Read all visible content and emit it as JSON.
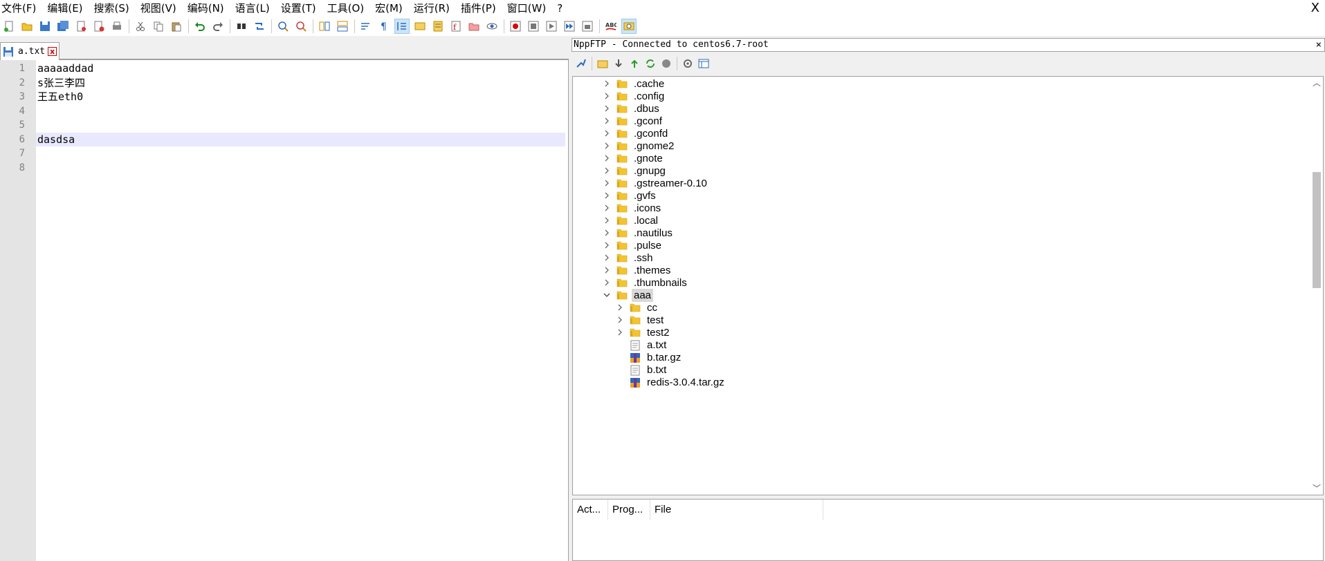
{
  "menu": [
    "文件(F)",
    "编辑(E)",
    "搜索(S)",
    "视图(V)",
    "编码(N)",
    "语言(L)",
    "设置(T)",
    "工具(O)",
    "宏(M)",
    "运行(R)",
    "插件(P)",
    "窗口(W)",
    "?"
  ],
  "window_close": "X",
  "tab": {
    "label": "a.txt",
    "close": "x"
  },
  "editor": {
    "lines": [
      {
        "num": "1",
        "text": "aaaaaddad"
      },
      {
        "num": "2",
        "text": "s张三李四"
      },
      {
        "num": "3",
        "text": "王五eth0"
      },
      {
        "num": "4",
        "text": ""
      },
      {
        "num": "5",
        "text": ""
      },
      {
        "num": "6",
        "text": "dasdsa"
      },
      {
        "num": "7",
        "text": ""
      },
      {
        "num": "8",
        "text": ""
      }
    ],
    "current_line": 6
  },
  "ftp": {
    "title": "NppFTP - Connected to centos6.7-root",
    "close": "×",
    "tree": [
      {
        "label": ".cache",
        "type": "folder",
        "expanded": false
      },
      {
        "label": ".config",
        "type": "folder",
        "expanded": false
      },
      {
        "label": ".dbus",
        "type": "folder",
        "expanded": false
      },
      {
        "label": ".gconf",
        "type": "folder",
        "expanded": false
      },
      {
        "label": ".gconfd",
        "type": "folder",
        "expanded": false
      },
      {
        "label": ".gnome2",
        "type": "folder",
        "expanded": false
      },
      {
        "label": ".gnote",
        "type": "folder",
        "expanded": false
      },
      {
        "label": ".gnupg",
        "type": "folder",
        "expanded": false
      },
      {
        "label": ".gstreamer-0.10",
        "type": "folder",
        "expanded": false
      },
      {
        "label": ".gvfs",
        "type": "folder",
        "expanded": false
      },
      {
        "label": ".icons",
        "type": "folder",
        "expanded": false
      },
      {
        "label": ".local",
        "type": "folder",
        "expanded": false
      },
      {
        "label": ".nautilus",
        "type": "folder",
        "expanded": false
      },
      {
        "label": ".pulse",
        "type": "folder",
        "expanded": false
      },
      {
        "label": ".ssh",
        "type": "folder",
        "expanded": false
      },
      {
        "label": ".themes",
        "type": "folder",
        "expanded": false
      },
      {
        "label": ".thumbnails",
        "type": "folder",
        "expanded": false
      },
      {
        "label": "aaa",
        "type": "folder",
        "expanded": true,
        "selected": true
      },
      {
        "label": "cc",
        "type": "folder",
        "expanded": false,
        "child": true
      },
      {
        "label": "test",
        "type": "folder",
        "expanded": false,
        "child": true
      },
      {
        "label": "test2",
        "type": "folder",
        "expanded": false,
        "child": true
      },
      {
        "label": "a.txt",
        "type": "file",
        "child": true
      },
      {
        "label": "b.tar.gz",
        "type": "archive",
        "child": true
      },
      {
        "label": "b.txt",
        "type": "file",
        "child": true
      },
      {
        "label": "redis-3.0.4.tar.gz",
        "type": "archive",
        "child": true
      }
    ],
    "queue_columns": [
      "Act...",
      "Prog...",
      "File"
    ]
  },
  "colors": {
    "folder": "#f4c430",
    "current_line_bg": "#e8e8ff",
    "gutter_bg": "#e4e4e4"
  }
}
